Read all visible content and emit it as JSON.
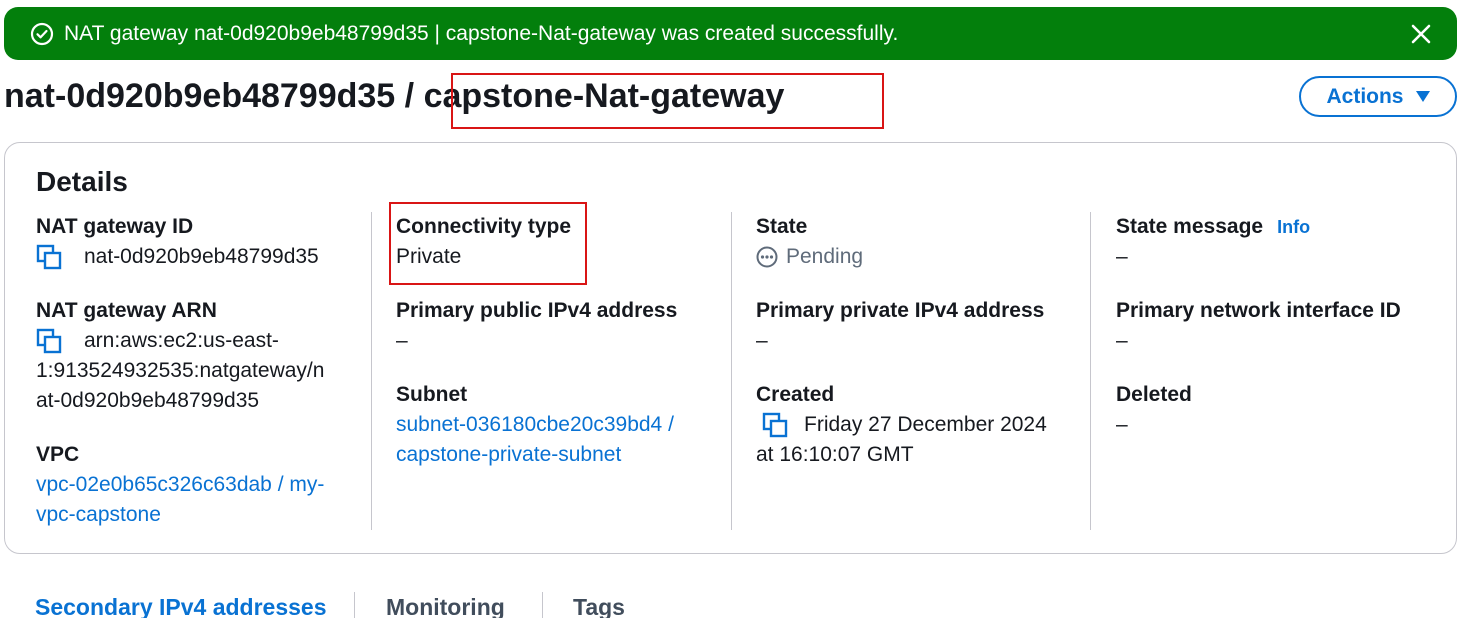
{
  "banner": {
    "message": "NAT gateway nat-0d920b9eb48799d35 | capstone-Nat-gateway was created successfully.",
    "icon": "check-circle-icon",
    "close_icon": "close-icon",
    "color": "#037f0c"
  },
  "header": {
    "id_part": "nat-0d920b9eb48799d35",
    "separator": " / ",
    "name_part": "capstone-Nat-gateway",
    "actions_label": "Actions"
  },
  "details": {
    "title": "Details",
    "nat_gateway_id": {
      "label": "NAT gateway ID",
      "value": "nat-0d920b9eb48799d35"
    },
    "nat_gateway_arn": {
      "label": "NAT gateway ARN",
      "value_lines": [
        "arn:aws:ec2:us-east-",
        "1:913524932535:natgateway/n",
        "at-0d920b9eb48799d35"
      ]
    },
    "vpc": {
      "label": "VPC",
      "value_lines": [
        "vpc-02e0b65c326c63dab / my-",
        "vpc-capstone"
      ]
    },
    "connectivity_type": {
      "label": "Connectivity type",
      "value": "Private"
    },
    "primary_public_ipv4": {
      "label": "Primary public IPv4 address",
      "value": "–"
    },
    "subnet": {
      "label": "Subnet",
      "value_lines": [
        "subnet-036180cbe20c39bd4 /",
        "capstone-private-subnet"
      ]
    },
    "state": {
      "label": "State",
      "value": "Pending"
    },
    "primary_private_ipv4": {
      "label": "Primary private IPv4 address",
      "value": "–"
    },
    "created": {
      "label": "Created",
      "value_lines": [
        "Friday 27 December 2024",
        "at 16:10:07 GMT"
      ]
    },
    "state_message": {
      "label": "State message",
      "info": "Info",
      "value": "–"
    },
    "primary_network_interface": {
      "label": "Primary network interface ID",
      "value": "–"
    },
    "deleted": {
      "label": "Deleted",
      "value": "–"
    }
  },
  "tabs": [
    {
      "label": "Secondary IPv4 addresses",
      "active": true
    },
    {
      "label": "Monitoring",
      "active": false
    },
    {
      "label": "Tags",
      "active": false
    }
  ],
  "colors": {
    "link": "#0972d3",
    "highlight": "#d91515",
    "text": "#16191f",
    "muted": "#5f6b7a"
  }
}
